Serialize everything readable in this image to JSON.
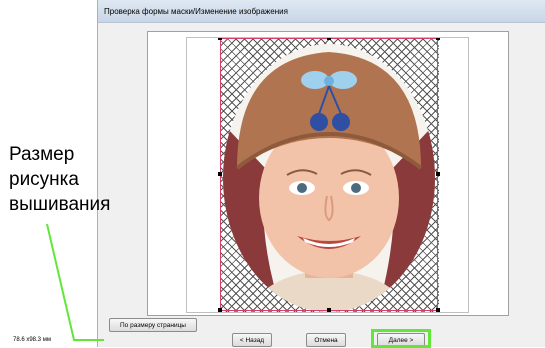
{
  "window": {
    "title": "Проверка формы маски/Изменение изображения"
  },
  "buttons": {
    "fit_page": "По размеру страницы",
    "back": "< Назад",
    "cancel": "Отмена",
    "next": "Далее >"
  },
  "status": {
    "size_text": "78.6 x98.3 мм"
  },
  "annotation": {
    "lines": [
      "Размер",
      "рисунка",
      "вышивания"
    ]
  },
  "colors": {
    "highlight": "#63e63a",
    "mask_border": "#d0406a",
    "leader_line": "#63e63a"
  },
  "icons": {
    "photo": "girl-portrait-photo"
  }
}
